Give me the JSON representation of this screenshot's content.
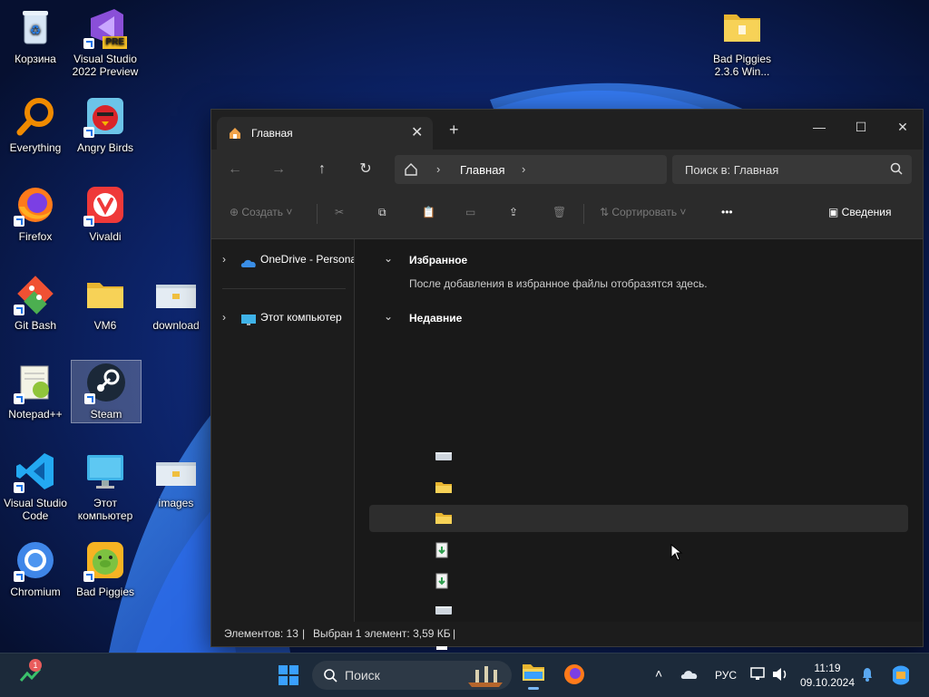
{
  "desktop": {
    "icons": [
      {
        "label": "Корзина"
      },
      {
        "label": "Visual Studio 2022 Preview"
      },
      {
        "label": "Everything"
      },
      {
        "label": "Angry Birds"
      },
      {
        "label": "Firefox"
      },
      {
        "label": "Vivaldi"
      },
      {
        "label": "Git Bash"
      },
      {
        "label": "VM6"
      },
      {
        "label": "download"
      },
      {
        "label": "Notepad++"
      },
      {
        "label": "Steam"
      },
      {
        "label": "Visual Studio Code"
      },
      {
        "label": "Этот компьютер"
      },
      {
        "label": "images"
      },
      {
        "label": "Chromium"
      },
      {
        "label": "Bad Piggies"
      },
      {
        "label": "Bad Piggies 2.3.6 Win..."
      }
    ],
    "vs_badge": "PRE"
  },
  "explorer": {
    "tab_title": "Главная",
    "new_tab": "+",
    "address": {
      "location": "Главная"
    },
    "search": {
      "placeholder": "Поиск в: Главная"
    },
    "toolbar": {
      "create": "Создать",
      "sort": "Сортировать",
      "more": "•••",
      "details": "Сведения"
    },
    "nav_pane": {
      "items": [
        {
          "label": "OneDrive - Personal"
        },
        {
          "label": "Этот компьютер"
        }
      ]
    },
    "favorites": {
      "heading": "Избранное",
      "empty_note": "После добавления в избранное файлы отобразятся здесь."
    },
    "recent": {
      "heading": "Недавние",
      "items": [
        {
          "icon": "drive-icon"
        },
        {
          "icon": "folder-icon"
        },
        {
          "icon": "folder-icon",
          "selected": true
        },
        {
          "icon": "installer-icon"
        },
        {
          "icon": "installer-icon"
        },
        {
          "icon": "drive-icon"
        },
        {
          "icon": "document-icon"
        }
      ]
    },
    "status": {
      "count": "Элементов: 13",
      "selection": "Выбран 1 элемент: 3,59 КБ"
    }
  },
  "taskbar": {
    "search_placeholder": "Поиск",
    "language": "РУС",
    "time": "11:19",
    "date": "09.10.2024",
    "widget_badge": "1"
  },
  "colors": {
    "window_bg": "#1c1c1c",
    "accent": "#60cdff",
    "folder": "#f0c040"
  }
}
